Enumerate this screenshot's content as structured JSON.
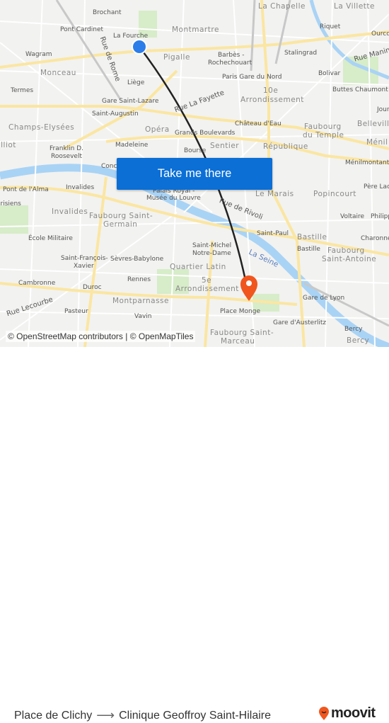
{
  "map": {
    "labels": [
      "Brochant",
      "Pont Cardinet",
      "La Fourche",
      "Montmartre",
      "La Chapelle",
      "La Villette",
      "Riquet",
      "Ourcq",
      "Wagram",
      "Rue de Rome",
      "Pigalle",
      "Barbès -",
      "Rochechouart",
      "Stalingrad",
      "Rue Manin",
      "Monceau",
      "Liège",
      "Paris Gare du Nord",
      "Bolivar",
      "Termes",
      "Gare Saint-Lazare",
      "Rue La Fayette",
      "10e",
      "Arrondissement",
      "Buttes Chaumont",
      "Saint-Augustin",
      "Château d'Eau",
      "Faubourg",
      "du Temple",
      "Belleville",
      "Champs-Elysées",
      "Opéra",
      "Grands Boulevards",
      "Madeleine",
      "Sentier",
      "République",
      "Ménil",
      "Franklin D.",
      "Roosevelt",
      "Bourse",
      "Ménilmontant",
      "Pont de l'Alma",
      "Invalides",
      "Père Lach",
      "Palais Royal -",
      "Musée du Louvre",
      "Le Marais",
      "Popincourt",
      "Invalides",
      "Faubourg Saint-",
      "Germain",
      "Rue de Rivoli",
      "Voltaire",
      "Philipp",
      "École Militaire",
      "Saint-Paul",
      "Bastille",
      "Charonne",
      "Saint-Michel",
      "Notre-Dame",
      "Bastille",
      "Faubourg",
      "Saint-Antoine",
      "Saint-François-",
      "Xavier",
      "Sèvres-Babylone",
      "La Seine",
      "Quartier Latin",
      "Rennes",
      "5e",
      "Arrondissement",
      "Cambronne",
      "Duroc",
      "Montparnasse",
      "Gare de Lyon",
      "Rue Lecourbe",
      "Pasteur",
      "Vavin",
      "Place Monge",
      "Gare d'Austerlitz",
      "Bercy",
      "Bercy",
      "Faubourg Saint-",
      "Marceau",
      "Concorde",
      "Jourdain",
      "Parisiens",
      "Elliot"
    ],
    "origin_marker_color": "#2b7de9",
    "destination_marker_color": "#f0561d",
    "route_line_color": "#222222",
    "river_color": "#a9d3f5",
    "road_color": "#fbe6a2"
  },
  "cta": {
    "label": "Take me there",
    "color": "#0b6fd6"
  },
  "attribution": "© OpenStreetMap contributors | © OpenMapTiles",
  "footer": {
    "origin": "Place de Clichy",
    "arrow_icon": "arrow-right-icon",
    "destination": "Clinique Geoffroy Saint-Hilaire",
    "logo_text": "moovit",
    "logo_color": "#f0561d"
  }
}
